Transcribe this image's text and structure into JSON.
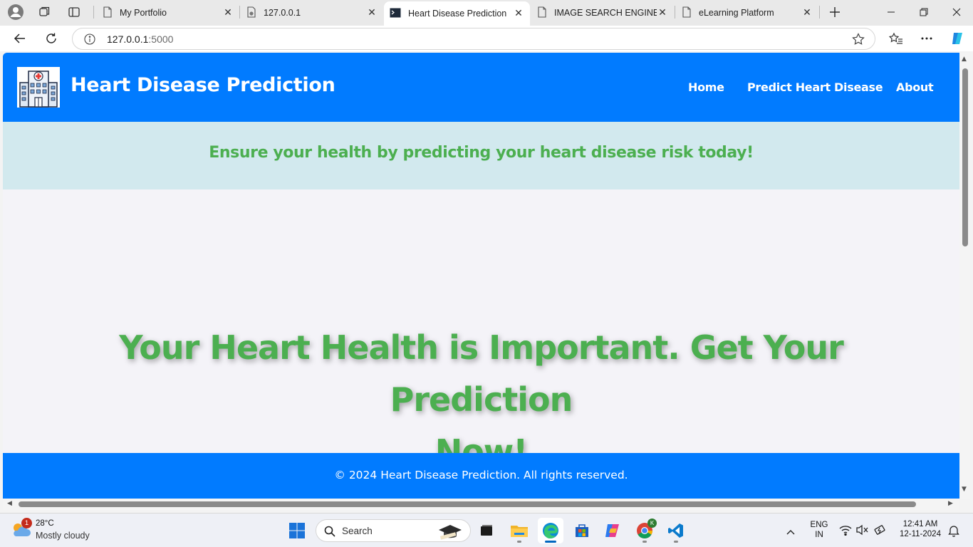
{
  "browser": {
    "tabs": [
      {
        "title": "My Portfolio",
        "active": false
      },
      {
        "title": "127.0.0.1",
        "active": false
      },
      {
        "title": "Heart Disease Prediction",
        "active": true
      },
      {
        "title": "IMAGE SEARCH ENGINE",
        "active": false
      },
      {
        "title": "eLearning Platform",
        "active": false
      }
    ],
    "address": {
      "host": "127.0.0.1",
      "port": ":5000"
    }
  },
  "site": {
    "title": "Heart Disease Prediction",
    "nav": {
      "home": "Home",
      "predict": "Predict Heart Disease",
      "about": "About"
    },
    "tagline": "Ensure your health by predicting your heart disease risk today!",
    "hero_line1": "Your Heart Health is Important. Get Your Prediction",
    "hero_line2": "Now!",
    "footer": "© 2024 Heart Disease Prediction. All rights reserved.",
    "colors": {
      "primary": "#017bff",
      "accent_green": "#4caf50",
      "band": "#d2e9ee",
      "body": "#f4f3f8"
    }
  },
  "taskbar": {
    "weather": {
      "temp": "28°C",
      "desc": "Mostly cloudy",
      "badge": "1"
    },
    "search_label": "Search",
    "lang": {
      "line1": "ENG",
      "line2": "IN"
    },
    "clock": {
      "time": "12:41 AM",
      "date": "12-11-2024"
    },
    "profile_badge": "K"
  }
}
